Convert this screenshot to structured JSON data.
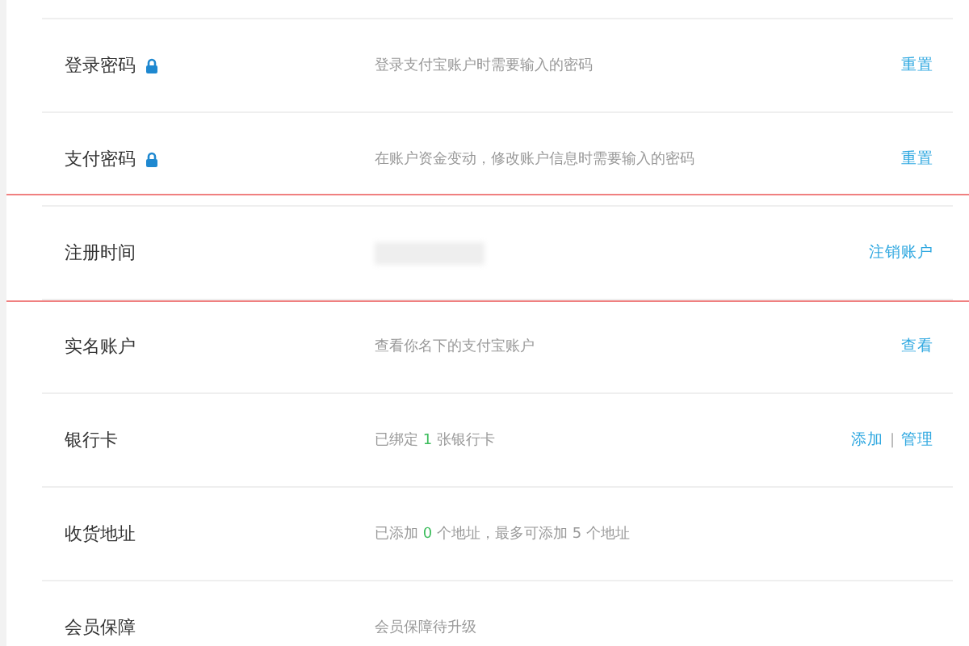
{
  "rows": [
    {
      "label": "登录密码",
      "locked": true,
      "highlighted": false,
      "description": [
        {
          "text": "登录支付宝账户时需要输入的密码"
        }
      ],
      "actions": [
        "重置"
      ]
    },
    {
      "label": "支付密码",
      "locked": true,
      "highlighted": false,
      "description": [
        {
          "text": "在账户资金变动，修改账户信息时需要输入的密码"
        }
      ],
      "actions": [
        "重置"
      ]
    },
    {
      "label": "注册时间",
      "locked": false,
      "highlighted": true,
      "blurred_value": true,
      "actions": [
        "注销账户"
      ]
    },
    {
      "label": "实名账户",
      "locked": false,
      "highlighted": false,
      "description": [
        {
          "text": "查看你名下的支付宝账户"
        }
      ],
      "actions": [
        "查看"
      ]
    },
    {
      "label": "银行卡",
      "locked": false,
      "highlighted": false,
      "description": [
        {
          "text": "已绑定 "
        },
        {
          "text": "1",
          "kind": "count"
        },
        {
          "text": " 张银行卡"
        }
      ],
      "actions": [
        "添加",
        "管理"
      ],
      "separator": "|"
    },
    {
      "label": "收货地址",
      "locked": false,
      "highlighted": false,
      "description": [
        {
          "text": "已添加 "
        },
        {
          "text": "0",
          "kind": "count"
        },
        {
          "text": " 个地址，最多可添加 5 个地址"
        }
      ],
      "actions": []
    },
    {
      "label": "会员保障",
      "locked": false,
      "highlighted": false,
      "description": [
        {
          "text": "会员保障待升级"
        }
      ],
      "actions": []
    }
  ]
}
